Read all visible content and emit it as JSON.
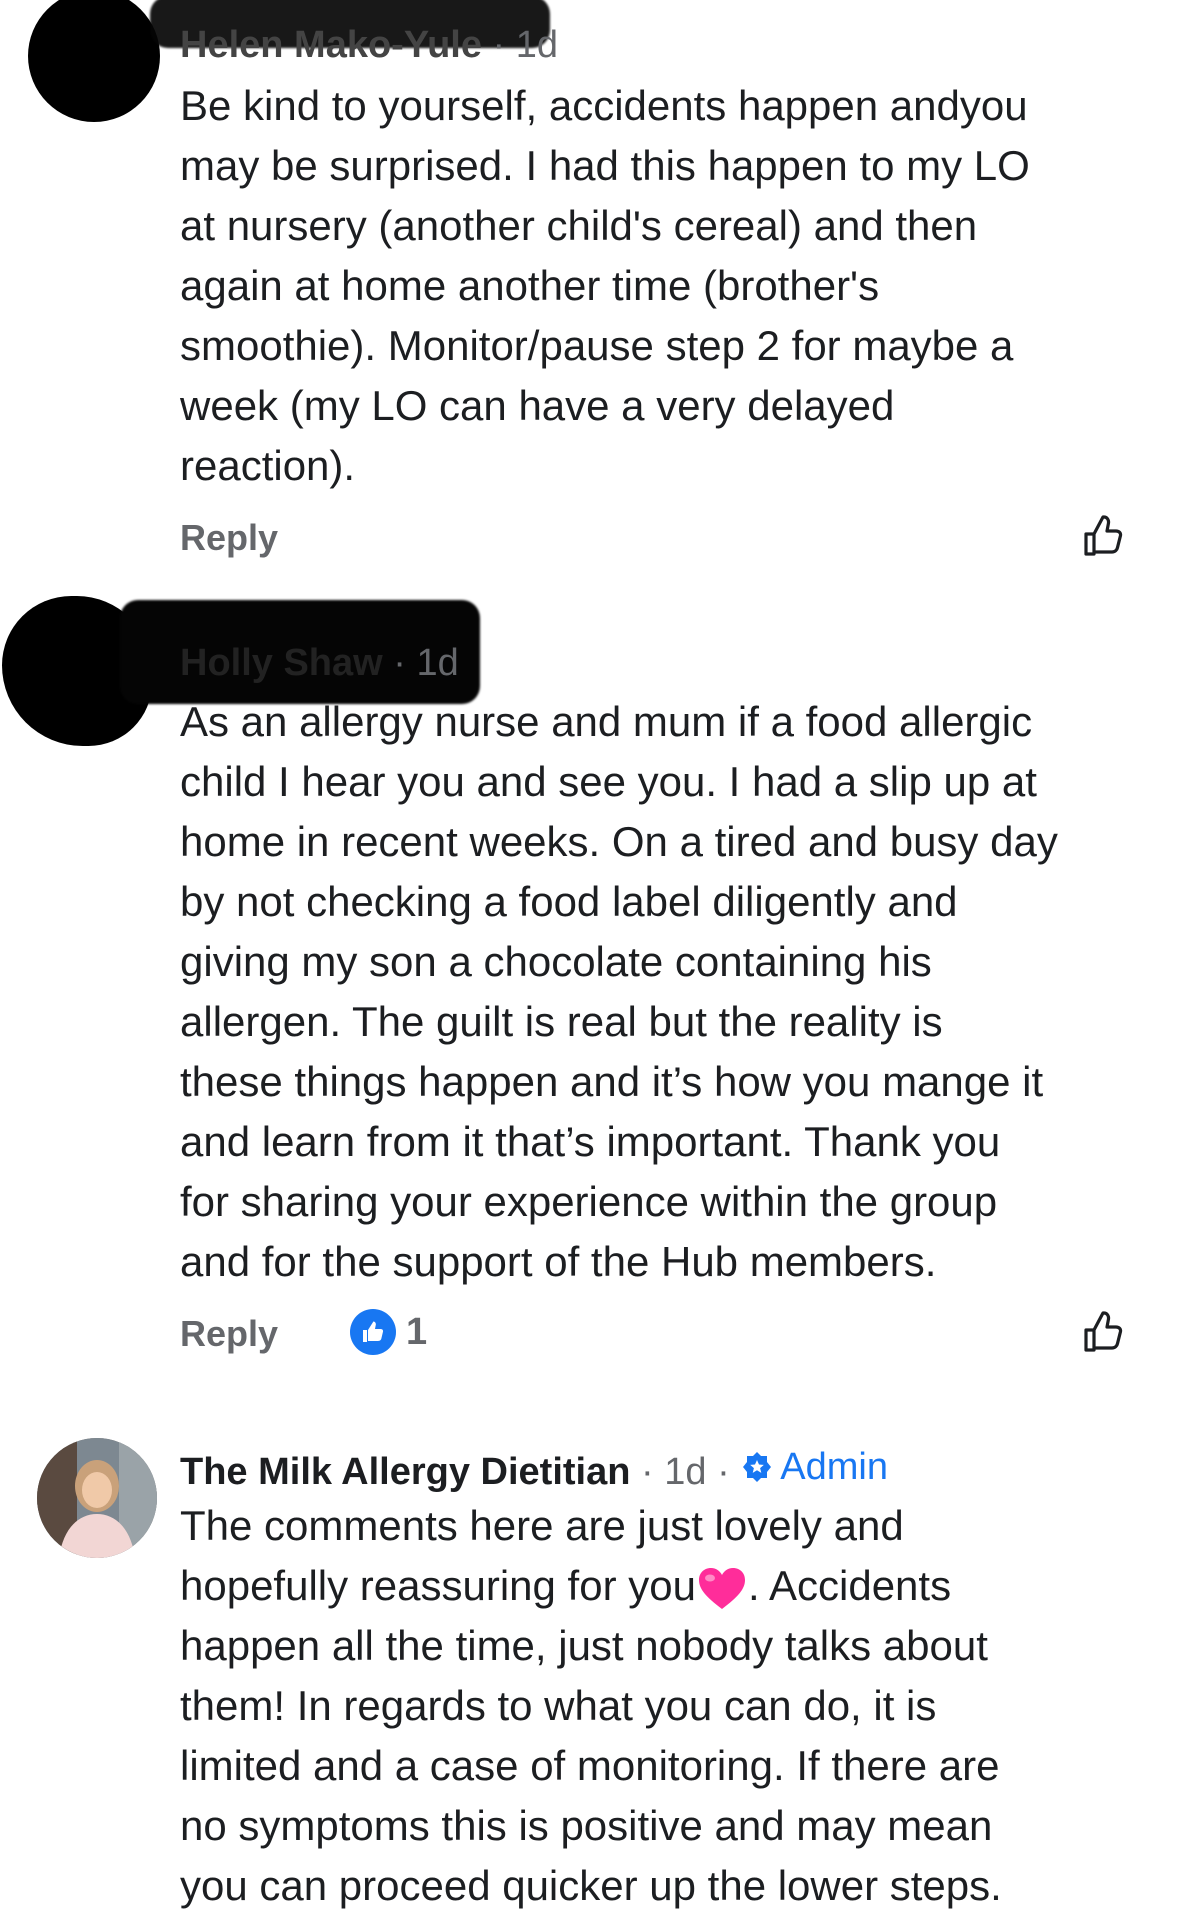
{
  "comments": [
    {
      "author": "Helen Mako-Yule",
      "time": "1d",
      "text": "Be kind to yourself, accidents happen  andyou\nmay be surprised. I had this happen to my LO\nat nursery (another child's cereal) and then\nagain at home another time (brother's\nsmoothie). Monitor/pause step 2 for maybe a\nweek (my LO can have a very delayed\nreaction).",
      "reply_label": "Reply"
    },
    {
      "author": "Holly Shaw",
      "time": "1d",
      "text": "As an allergy nurse and mum if a food allergic\nchild I hear you and see you. I had a slip up at\nhome in recent weeks. On a tired and busy day\nby not checking a food label diligently and\ngiving my son a chocolate containing his\nallergen. The guilt is real but the reality is\nthese things happen and it’s how you mange it\nand learn from it that’s important. Thank you\nfor sharing your experience within the group\nand for the support of the Hub members.",
      "reply_label": "Reply",
      "reaction_count": "1"
    },
    {
      "author": "The Milk Allergy Dietitian",
      "time": "1d",
      "badge": "Admin",
      "text_part1": "The comments here are just lovely and\nhopefully reassuring for you",
      "text_part2": ". Accidents\nhappen all the time, just nobody talks about\nthem! In regards to what you can do, it is\nlimited and a case of monitoring. If there are\nno symptoms this is positive and may mean\nyou can proceed quicker up the lower steps."
    }
  ],
  "separator": "·",
  "colors": {
    "text": "#1c1e21",
    "muted": "#65676b",
    "accent": "#1877f2",
    "heart": "#ff2d9a"
  },
  "icons": {
    "like": "thumbs-up-outline-icon",
    "reaction": "thumbs-up-filled-icon",
    "admin": "star-badge-icon",
    "heart": "pink-heart-emoji"
  }
}
